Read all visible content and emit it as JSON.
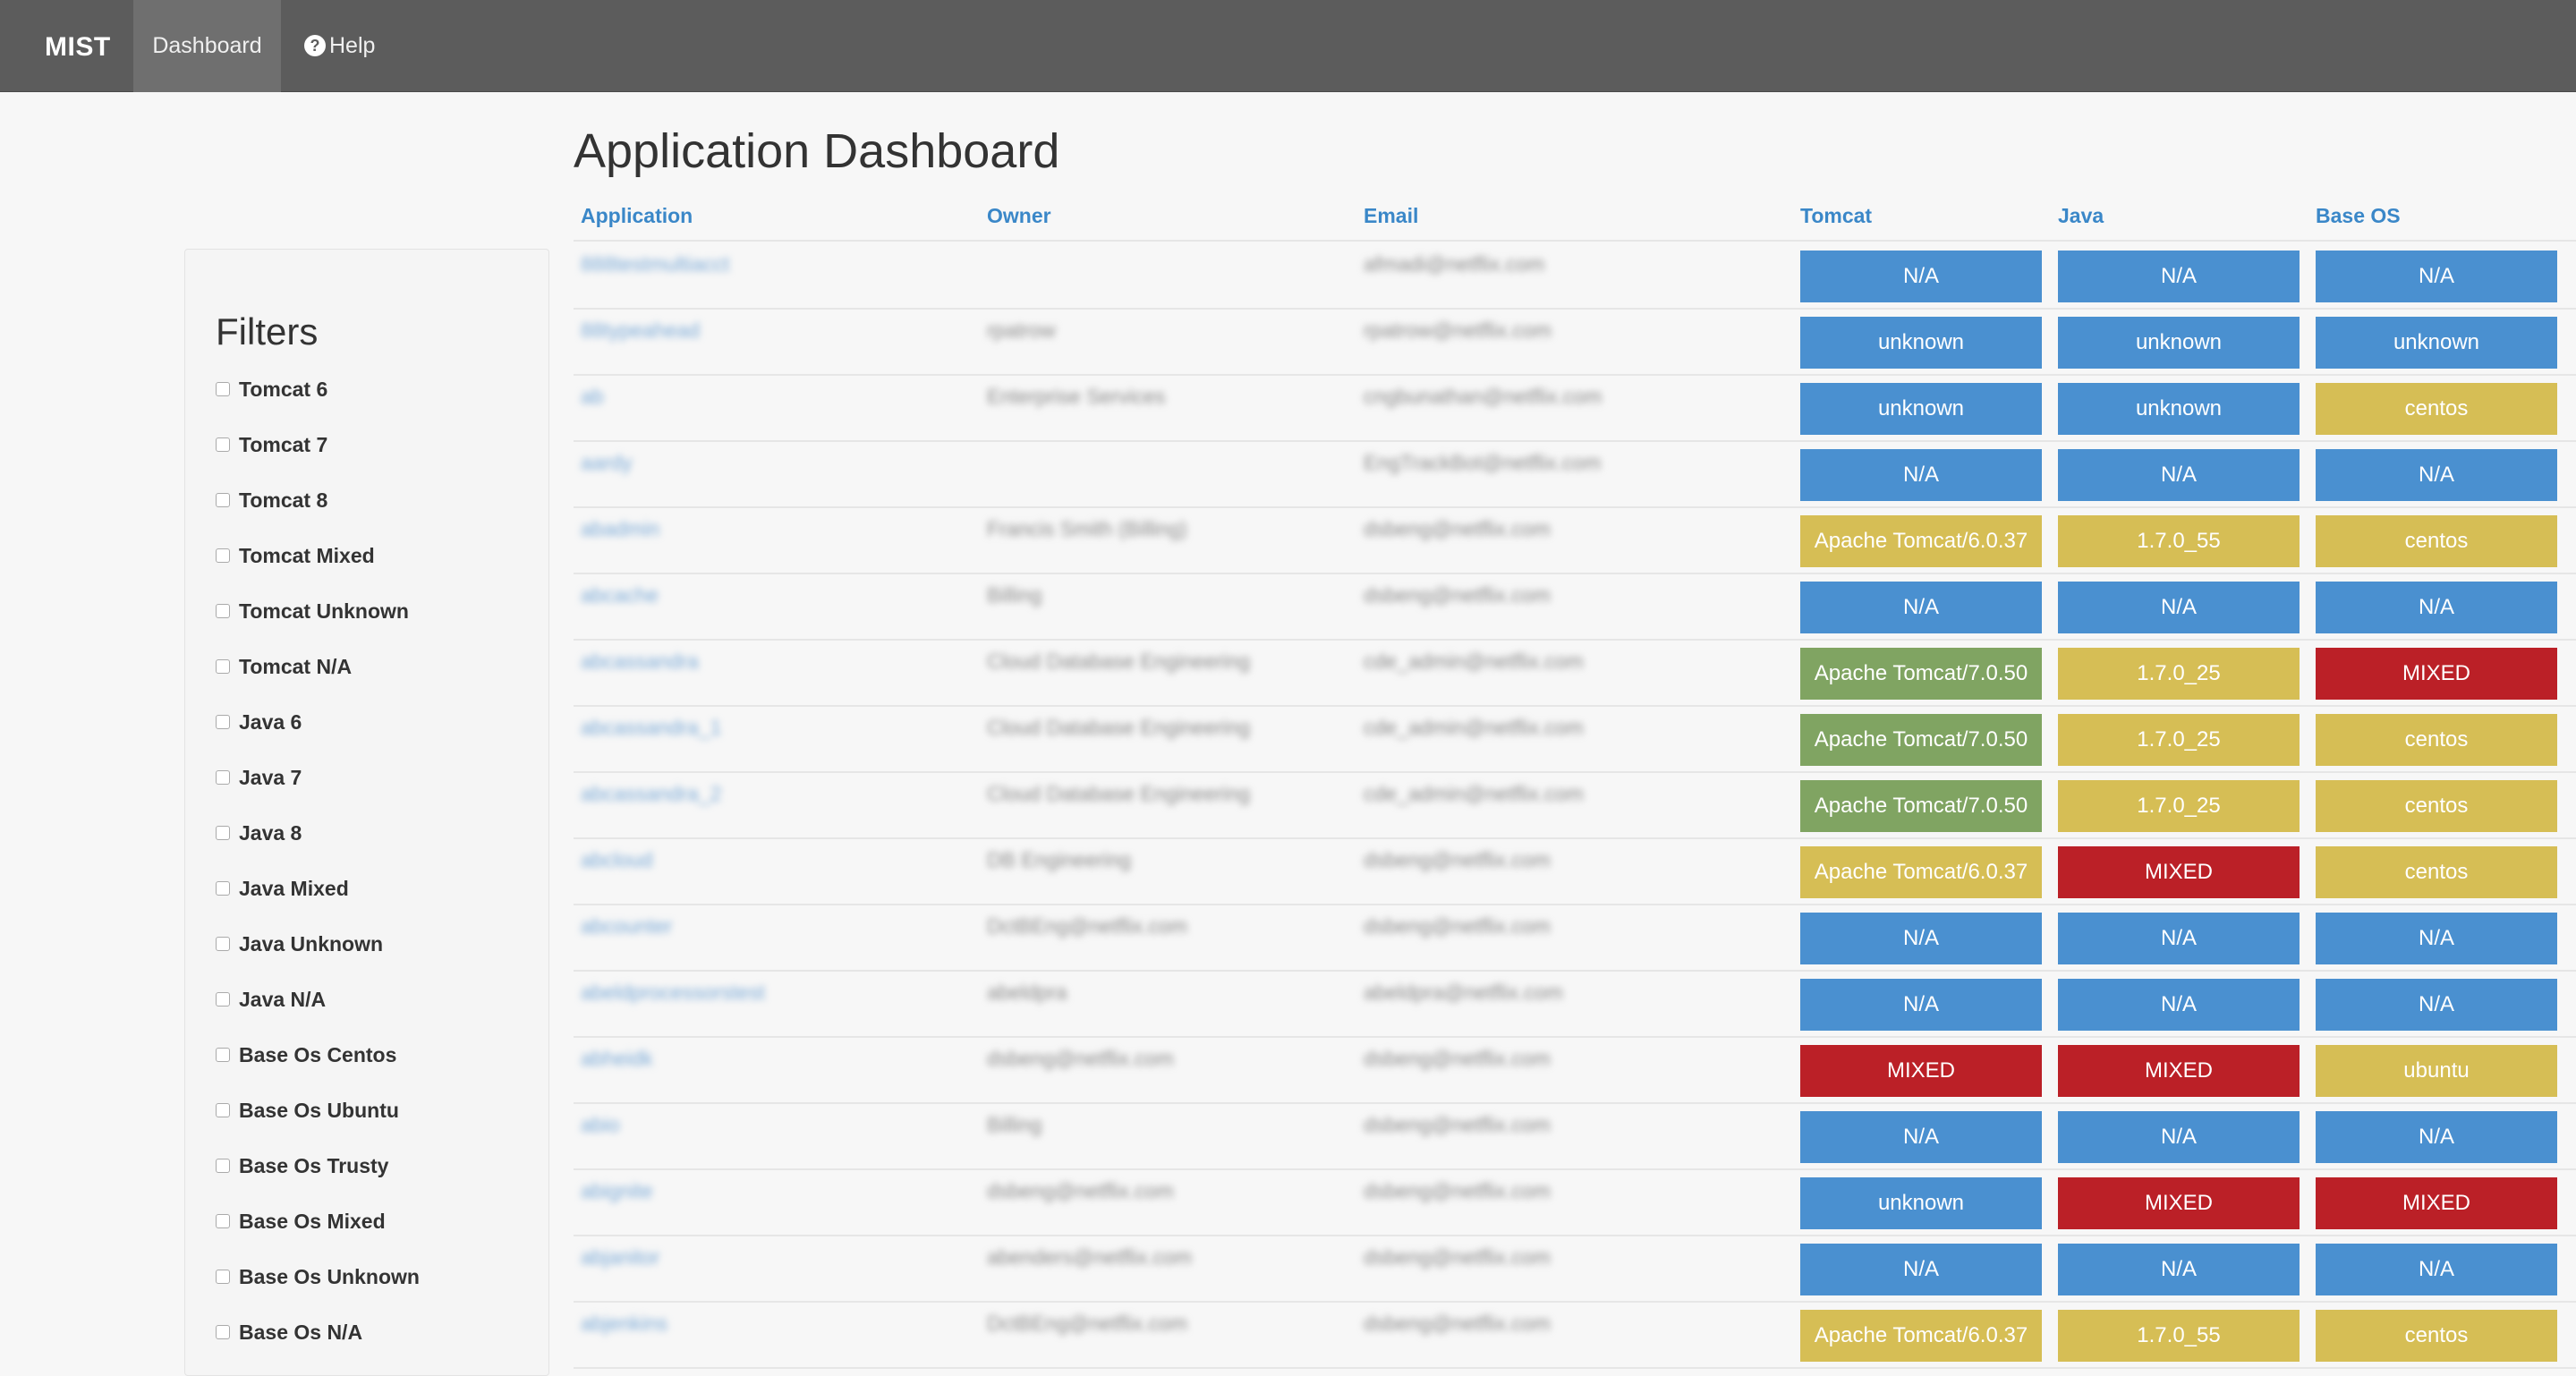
{
  "nav": {
    "brand": "MIST",
    "items": [
      {
        "label": "Dashboard",
        "active": true
      },
      {
        "label": "Help",
        "icon": "question-circle-icon"
      }
    ]
  },
  "page_title": "Application Dashboard",
  "filters": {
    "title": "Filters",
    "options": [
      "Tomcat 6",
      "Tomcat 7",
      "Tomcat 8",
      "Tomcat Mixed",
      "Tomcat Unknown",
      "Tomcat N/A",
      "Java 6",
      "Java 7",
      "Java 8",
      "Java Mixed",
      "Java Unknown",
      "Java N/A",
      "Base Os Centos",
      "Base Os Ubuntu",
      "Base Os Trusty",
      "Base Os Mixed",
      "Base Os Unknown",
      "Base Os N/A"
    ]
  },
  "table": {
    "headers": [
      "Application",
      "Owner",
      "Email",
      "Tomcat",
      "Java",
      "Base OS"
    ],
    "rows": [
      {
        "app": "888testmultiacct",
        "owner": "",
        "email": "afmadi@netflix.com",
        "tomcat": "N/A",
        "java": "N/A",
        "os": "N/A"
      },
      {
        "app": "88typeahead",
        "owner": "rpatrow",
        "email": "rpatrow@netflix.com",
        "tomcat": "unknown",
        "java": "unknown",
        "os": "unknown"
      },
      {
        "app": "ab",
        "owner": "Enterprise Services",
        "email": "cngbunathan@netflix.com",
        "tomcat": "unknown",
        "java": "unknown",
        "os": "centos"
      },
      {
        "app": "aardy",
        "owner": "",
        "email": "EngTrackBot@netflix.com",
        "tomcat": "N/A",
        "java": "N/A",
        "os": "N/A"
      },
      {
        "app": "abadmin",
        "owner": "Francis Smith (Billing)",
        "email": "dsbeng@netflix.com",
        "tomcat": "Apache Tomcat/6.0.37",
        "java": "1.7.0_55",
        "os": "centos"
      },
      {
        "app": "abcache",
        "owner": "Billing",
        "email": "dsbeng@netflix.com",
        "tomcat": "N/A",
        "java": "N/A",
        "os": "N/A"
      },
      {
        "app": "abcassandra",
        "owner": "Cloud Database Engineering",
        "email": "cde_admin@netflix.com",
        "tomcat": "Apache Tomcat/7.0.50",
        "java": "1.7.0_25",
        "os": "MIXED"
      },
      {
        "app": "abcassandra_1",
        "owner": "Cloud Database Engineering",
        "email": "cde_admin@netflix.com",
        "tomcat": "Apache Tomcat/7.0.50",
        "java": "1.7.0_25",
        "os": "centos"
      },
      {
        "app": "abcassandra_2",
        "owner": "Cloud Database Engineering",
        "email": "cde_admin@netflix.com",
        "tomcat": "Apache Tomcat/7.0.50",
        "java": "1.7.0_25",
        "os": "centos"
      },
      {
        "app": "abcloud",
        "owner": "DB Engineering",
        "email": "dsbeng@netflix.com",
        "tomcat": "Apache Tomcat/6.0.37",
        "java": "MIXED",
        "os": "centos"
      },
      {
        "app": "abcounter",
        "owner": "DctBEng@netflix.com",
        "email": "dsbeng@netflix.com",
        "tomcat": "N/A",
        "java": "N/A",
        "os": "N/A"
      },
      {
        "app": "abeldprocessorstest",
        "owner": "abeldpra",
        "email": "abeldpra@netflix.com",
        "tomcat": "N/A",
        "java": "N/A",
        "os": "N/A"
      },
      {
        "app": "abheidk",
        "owner": "dsbeng@netflix.com",
        "email": "dsbeng@netflix.com",
        "tomcat": "MIXED",
        "java": "MIXED",
        "os": "ubuntu"
      },
      {
        "app": "abio",
        "owner": "Billing",
        "email": "dsbeng@netflix.com",
        "tomcat": "N/A",
        "java": "N/A",
        "os": "N/A"
      },
      {
        "app": "abignite",
        "owner": "dsbeng@netflix.com",
        "email": "dsbeng@netflix.com",
        "tomcat": "unknown",
        "java": "MIXED",
        "os": "MIXED"
      },
      {
        "app": "abjanitor",
        "owner": "abenders@netflix.com",
        "email": "dsbeng@netflix.com",
        "tomcat": "N/A",
        "java": "N/A",
        "os": "N/A"
      },
      {
        "app": "abjenkins",
        "owner": "DctBEng@netflix.com",
        "email": "dsbeng@netflix.com",
        "tomcat": "Apache Tomcat/6.0.37",
        "java": "1.7.0_55",
        "os": "centos"
      }
    ]
  },
  "colors": {
    "blue": "#4a90d0",
    "yellow": "#d6be55",
    "green": "#80a462",
    "red": "#bb2027"
  }
}
